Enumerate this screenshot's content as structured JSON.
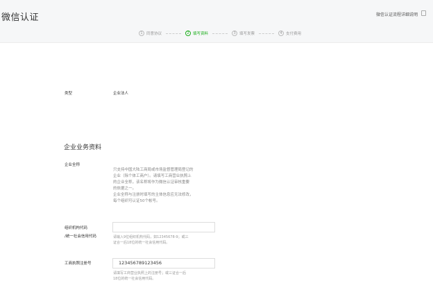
{
  "header": {
    "title": "微信认证",
    "help_link": "微信认证流程详细说明"
  },
  "steps": [
    {
      "num": "1",
      "label": "同意协议",
      "active": false
    },
    {
      "num": "2",
      "label": "填写资料",
      "active": true
    },
    {
      "num": "3",
      "label": "填写发票",
      "active": false
    },
    {
      "num": "4",
      "label": "支付费用",
      "active": false
    }
  ],
  "form": {
    "type_label": "类型",
    "type_value": "企业法人",
    "section_title": "企业业务资料",
    "company_name_label": "企业全称",
    "company_name_desc": [
      "只支持中国大陆工商局或市场监督管理局登记的",
      "企业（除个体工商户）。请填写工商营业执照上",
      "的企业全称，该名称将作为微信认证审核重要",
      "的依据之一。",
      "企业全称与注册时填写的主体信息应无法修改，",
      "每个组织可认证50个帐号。"
    ],
    "org_code_label_1": "组织机构代码",
    "org_code_label_2": "/统一社会信用代码",
    "org_code_placeholder": "",
    "org_code_hint": [
      "请输入9位组织机构代码，如12345678-9；或三",
      "证合一后18位的统一社会信用代码。"
    ],
    "reg_no_label": "工商执照注册号",
    "reg_no_value": "123456789123456",
    "reg_no_hint": [
      "请填写工商营业执照上的注册号；或三证合一后",
      "18位的统一社会信用代码。"
    ]
  }
}
